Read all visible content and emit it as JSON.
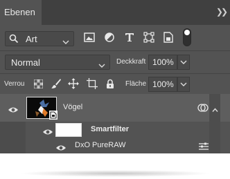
{
  "panel": {
    "tab_label": "Ebenen",
    "collapse_icon": "double-chevron-right-icon"
  },
  "filter": {
    "kind_label": "Art",
    "icons": [
      "image-filter-icon",
      "adjustment-filter-icon",
      "type-filter-icon",
      "shape-filter-icon",
      "smartobject-filter-icon"
    ]
  },
  "blend": {
    "mode": "Normal",
    "opacity_label": "Deckkraft",
    "opacity_value": "100%"
  },
  "lock": {
    "label": "Verrou",
    "icons": [
      "lock-transparent-pixels-icon",
      "lock-image-pixels-icon",
      "lock-position-icon",
      "lock-artboard-icon",
      "lock-all-icon"
    ],
    "fill_label": "Fläche",
    "fill_value": "100%"
  },
  "layers": [
    {
      "name": "Vögel",
      "type": "smart-object",
      "visible": true
    },
    {
      "name": "Smartfilter",
      "type": "filter-mask",
      "visible": true
    },
    {
      "name": "DxO PureRAW",
      "type": "filter",
      "visible": true
    }
  ]
}
